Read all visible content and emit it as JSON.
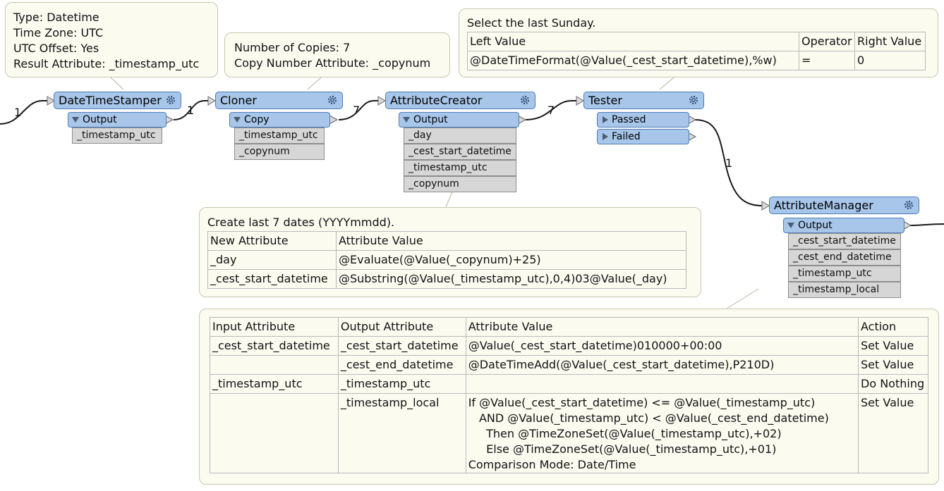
{
  "notes": {
    "datetimestamper": [
      "Type: Datetime",
      "Time Zone: UTC",
      "UTC Offset: Yes",
      "Result Attribute: _timestamp_utc"
    ],
    "cloner": [
      "Number of Copies: 7",
      "Copy Number Attribute: _copynum"
    ],
    "tester": {
      "title": "Select the last Sunday.",
      "headers": [
        "Left Value",
        "Operator",
        "Right Value"
      ],
      "row": [
        "@DateTimeFormat(@Value(_cest_start_datetime),%w)",
        "=",
        "0"
      ]
    },
    "attributecreator": {
      "title": "Create last 7 dates (YYYYmmdd).",
      "headers": [
        "New Attribute",
        "Attribute Value"
      ],
      "rows": [
        [
          "_day",
          "@Evaluate(@Value(_copynum)+25)"
        ],
        [
          "_cest_start_datetime",
          "@Substring(@Value(_timestamp_utc),0,4)03@Value(_day)"
        ]
      ]
    },
    "attributemanager": {
      "headers": [
        "Input Attribute",
        "Output Attribute",
        "Attribute Value",
        "Action"
      ],
      "rows": [
        [
          "_cest_start_datetime",
          "_cest_start_datetime",
          "@Value(_cest_start_datetime)010000+00:00",
          "Set Value"
        ],
        [
          "",
          "_cest_end_datetime",
          "@DateTimeAdd(@Value(_cest_start_datetime),P210D)",
          "Set Value"
        ],
        [
          "_timestamp_utc",
          "_timestamp_utc",
          "",
          "Do Nothing"
        ],
        [
          "",
          "_timestamp_local",
          "If @Value(_cest_start_datetime) <= @Value(_timestamp_utc)\n   AND @Value(_timestamp_utc) < @Value(_cest_end_datetime)\n     Then @TimeZoneSet(@Value(_timestamp_utc),+02)\n     Else @TimeZoneSet(@Value(_timestamp_utc),+01)\nComparison Mode: Date/Time",
          "Set Value"
        ]
      ]
    }
  },
  "transformers": {
    "datetimestamper": {
      "name": "DateTimeStamper",
      "ports": [
        "Output"
      ],
      "attrs": [
        "_timestamp_utc"
      ]
    },
    "cloner": {
      "name": "Cloner",
      "ports": [
        "Copy"
      ],
      "attrs": [
        "_timestamp_utc",
        "_copynum"
      ]
    },
    "attributecreator": {
      "name": "AttributeCreator",
      "ports": [
        "Output"
      ],
      "attrs": [
        "_day",
        "_cest_start_datetime",
        "_timestamp_utc",
        "_copynum"
      ]
    },
    "tester": {
      "name": "Tester",
      "ports": [
        "Passed",
        "Failed"
      ]
    },
    "attributemanager": {
      "name": "AttributeManager",
      "ports": [
        "Output"
      ],
      "attrs": [
        "_cest_start_datetime",
        "_cest_end_datetime",
        "_timestamp_utc",
        "_timestamp_local"
      ]
    }
  },
  "counts": {
    "in_dts": "1",
    "dts_cloner": "1",
    "cloner_ac": "7",
    "ac_tester": "7",
    "tester_am": "1"
  },
  "icons": {
    "gear": "gear-icon",
    "port_open": "triangle-down-icon",
    "port_closed": "triangle-right-icon"
  },
  "colors": {
    "transformer": "#a7c6e9",
    "transformer_border": "#4d7db7",
    "attribute": "#d6d6d6",
    "note": "#fcfbf0"
  }
}
